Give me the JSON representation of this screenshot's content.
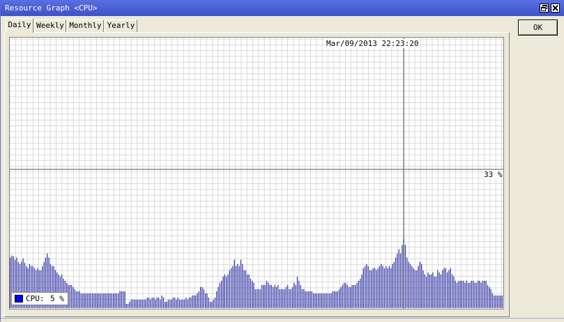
{
  "window": {
    "title": "Resource Graph <CPU>"
  },
  "tabs": [
    {
      "label": "Daily",
      "active": true
    },
    {
      "label": "Weekly",
      "active": false
    },
    {
      "label": "Monthly",
      "active": false
    },
    {
      "label": "Yearly",
      "active": false
    }
  ],
  "ok_button": {
    "label": "OK"
  },
  "graph": {
    "cursor_timestamp": "Mar/09/2013 22:23:20",
    "max_label": "33 %",
    "legend": {
      "name": "CPU:",
      "value": "5 %",
      "color": "#0000ff"
    },
    "bar_color": "#3838a8",
    "grid_color": "#d9d9d9",
    "max_percent": 33,
    "cpu_percent": [
      12.0,
      12.5,
      12.3,
      11.5,
      12.0,
      11.0,
      10.5,
      11.0,
      11.8,
      10.8,
      10.0,
      9.5,
      10.5,
      10.0,
      10.0,
      9.5,
      9.0,
      9.5,
      9.0,
      9.0,
      10.0,
      11.0,
      12.0,
      13.0,
      12.0,
      10.5,
      10.0,
      10.0,
      9.0,
      8.5,
      8.0,
      7.5,
      8.0,
      7.0,
      6.5,
      6.0,
      5.5,
      5.5,
      5.5,
      5.0,
      4.5,
      4.0,
      4.0,
      4.0,
      3.5,
      3.5,
      3.5,
      3.5,
      3.5,
      3.5,
      3.5,
      3.5,
      3.5,
      3.5,
      3.5,
      3.5,
      3.5,
      3.5,
      3.5,
      3.5,
      3.5,
      3.5,
      3.5,
      3.5,
      3.5,
      3.5,
      3.5,
      3.5,
      4.0,
      4.0,
      4.0,
      4.0,
      1.0,
      1.0,
      1.5,
      2.0,
      2.0,
      2.0,
      2.0,
      2.0,
      2.0,
      2.0,
      2.0,
      2.0,
      2.0,
      2.5,
      2.5,
      2.0,
      2.5,
      2.5,
      2.0,
      2.5,
      2.5,
      2.0,
      3.0,
      2.5,
      1.5,
      1.5,
      2.0,
      2.0,
      2.0,
      2.5,
      2.5,
      2.0,
      2.5,
      2.0,
      2.0,
      2.0,
      2.0,
      2.5,
      2.0,
      2.5,
      2.5,
      3.0,
      3.0,
      3.0,
      3.5,
      4.0,
      5.0,
      5.0,
      4.5,
      3.5,
      3.5,
      2.5,
      1.5,
      1.5,
      2.0,
      2.5,
      4.0,
      5.0,
      6.0,
      6.5,
      7.5,
      8.0,
      7.5,
      8.0,
      9.0,
      9.5,
      10.0,
      11.5,
      10.0,
      10.5,
      10.0,
      11.5,
      10.5,
      9.0,
      9.0,
      8.0,
      8.0,
      7.0,
      6.5,
      6.0,
      4.5,
      4.5,
      4.5,
      4.5,
      5.5,
      5.5,
      5.5,
      6.5,
      6.0,
      5.5,
      5.5,
      5.0,
      5.5,
      5.0,
      5.5,
      4.5,
      4.5,
      4.5,
      4.5,
      5.0,
      5.5,
      4.5,
      4.5,
      5.0,
      6.0,
      5.5,
      7.5,
      6.5,
      5.5,
      4.5,
      4.5,
      4.0,
      4.0,
      4.0,
      4.0,
      4.0,
      3.5,
      3.5,
      3.5,
      3.5,
      3.5,
      3.5,
      3.5,
      3.5,
      3.5,
      3.5,
      3.5,
      3.5,
      4.0,
      4.0,
      4.0,
      4.0,
      4.5,
      5.0,
      5.5,
      6.0,
      6.0,
      5.5,
      5.0,
      5.0,
      5.5,
      5.5,
      5.5,
      6.0,
      6.5,
      7.0,
      8.0,
      9.5,
      10.0,
      10.5,
      10.0,
      9.0,
      9.0,
      9.5,
      9.5,
      9.0,
      9.5,
      10.0,
      10.5,
      10.0,
      9.5,
      10.0,
      9.5,
      10.0,
      9.5,
      10.5,
      11.0,
      12.0,
      13.0,
      14.0,
      13.0,
      15.0,
      16.5,
      15.0,
      12.0,
      11.0,
      10.5,
      10.0,
      9.5,
      9.0,
      9.0,
      10.0,
      11.0,
      10.5,
      9.0,
      8.0,
      7.5,
      8.5,
      8.0,
      8.0,
      8.5,
      7.5,
      7.5,
      9.0,
      8.5,
      8.0,
      9.0,
      9.5,
      9.5,
      8.5,
      9.0,
      9.5,
      8.0,
      7.5,
      6.5,
      6.0,
      6.5,
      6.5,
      6.5,
      6.5,
      6.0,
      6.5,
      6.0,
      6.0,
      6.5,
      6.5,
      6.0,
      6.0,
      6.5,
      6.5,
      6.0,
      6.5,
      6.5,
      6.5,
      5.5,
      5.0,
      4.5,
      3.5,
      3.0,
      3.0,
      3.0,
      3.0,
      3.0,
      3.0
    ]
  }
}
